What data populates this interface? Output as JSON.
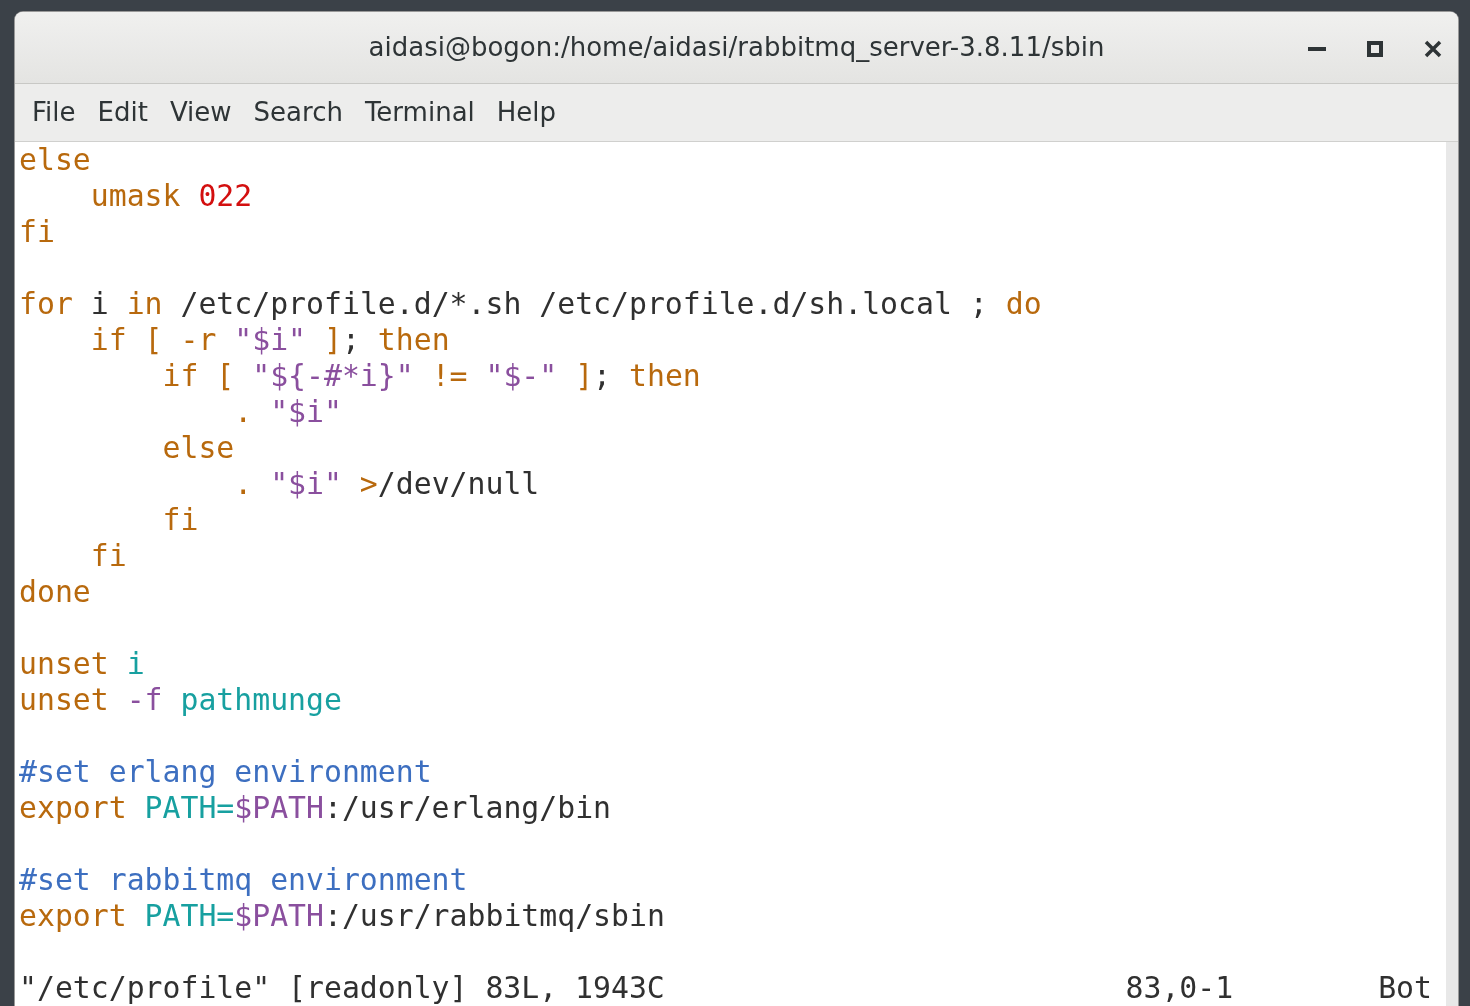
{
  "window": {
    "title": "aidasi@bogon:/home/aidasi/rabbitmq_server-3.8.11/sbin"
  },
  "menu": [
    "File",
    "Edit",
    "View",
    "Search",
    "Terminal",
    "Help"
  ],
  "lines": [
    {
      "kind": "code",
      "segments": [
        {
          "text": "else",
          "kind": "keyword"
        }
      ]
    },
    {
      "kind": "code",
      "segments": [
        {
          "text": "    umask ",
          "kind": "keyword"
        },
        {
          "text": "022",
          "kind": "number"
        }
      ]
    },
    {
      "kind": "code",
      "segments": [
        {
          "text": "fi",
          "kind": "keyword"
        }
      ]
    },
    {
      "kind": "blank"
    },
    {
      "kind": "code",
      "segments": [
        {
          "text": "for",
          "kind": "keyword"
        },
        {
          "text": " i ",
          "kind": "plain"
        },
        {
          "text": "in",
          "kind": "keyword"
        },
        {
          "text": " /etc/profile.d/*.sh /etc/profile.d/sh.local ; ",
          "kind": "plain"
        },
        {
          "text": "do",
          "kind": "keyword"
        }
      ]
    },
    {
      "kind": "code",
      "segments": [
        {
          "text": "    if [ -r ",
          "kind": "keyword"
        },
        {
          "text": "\"$i\"",
          "kind": "string"
        },
        {
          "text": " ]",
          "kind": "keyword"
        },
        {
          "text": ";",
          "kind": "plain"
        },
        {
          "text": " then",
          "kind": "keyword"
        }
      ]
    },
    {
      "kind": "code",
      "segments": [
        {
          "text": "        if [ ",
          "kind": "keyword"
        },
        {
          "text": "\"${-#*i}\"",
          "kind": "string"
        },
        {
          "text": " != ",
          "kind": "keyword"
        },
        {
          "text": "\"$-\"",
          "kind": "string"
        },
        {
          "text": " ]",
          "kind": "keyword"
        },
        {
          "text": ";",
          "kind": "plain"
        },
        {
          "text": " then",
          "kind": "keyword"
        }
      ]
    },
    {
      "kind": "code",
      "segments": [
        {
          "text": "            . ",
          "kind": "keyword"
        },
        {
          "text": "\"$i\"",
          "kind": "string"
        }
      ]
    },
    {
      "kind": "code",
      "segments": [
        {
          "text": "        else",
          "kind": "keyword"
        }
      ]
    },
    {
      "kind": "code",
      "segments": [
        {
          "text": "            . ",
          "kind": "keyword"
        },
        {
          "text": "\"$i\"",
          "kind": "string"
        },
        {
          "text": " >",
          "kind": "keyword"
        },
        {
          "text": "/dev/null",
          "kind": "plain"
        }
      ]
    },
    {
      "kind": "code",
      "segments": [
        {
          "text": "        fi",
          "kind": "keyword"
        }
      ]
    },
    {
      "kind": "code",
      "segments": [
        {
          "text": "    fi",
          "kind": "keyword"
        }
      ]
    },
    {
      "kind": "code",
      "segments": [
        {
          "text": "done",
          "kind": "keyword"
        }
      ]
    },
    {
      "kind": "blank"
    },
    {
      "kind": "code",
      "segments": [
        {
          "text": "unset",
          "kind": "keyword"
        },
        {
          "text": " i",
          "kind": "ident"
        }
      ]
    },
    {
      "kind": "code",
      "segments": [
        {
          "text": "unset",
          "kind": "keyword"
        },
        {
          "text": " -f",
          "kind": "string"
        },
        {
          "text": " pathmunge",
          "kind": "ident"
        }
      ]
    },
    {
      "kind": "blank"
    },
    {
      "kind": "code",
      "segments": [
        {
          "text": "#set erlang environment",
          "kind": "comment"
        }
      ]
    },
    {
      "kind": "code",
      "segments": [
        {
          "text": "export",
          "kind": "keyword"
        },
        {
          "text": " PATH=",
          "kind": "ident"
        },
        {
          "text": "$PATH",
          "kind": "string"
        },
        {
          "text": ":/usr/erlang/bin",
          "kind": "plain"
        }
      ]
    },
    {
      "kind": "blank"
    },
    {
      "kind": "code",
      "segments": [
        {
          "text": "#set rabbitmq environment",
          "kind": "comment"
        }
      ]
    },
    {
      "kind": "code",
      "segments": [
        {
          "text": "export",
          "kind": "keyword"
        },
        {
          "text": " PATH=",
          "kind": "ident"
        },
        {
          "text": "$PATH",
          "kind": "string"
        },
        {
          "text": ":/usr/rabbitmq/sbin",
          "kind": "plain"
        }
      ]
    },
    {
      "kind": "blank"
    }
  ],
  "status_bar": {
    "message": "\"/etc/profile\" [readonly] 83L, 1943C",
    "position": "83,0-1",
    "scroll": "Bot"
  }
}
